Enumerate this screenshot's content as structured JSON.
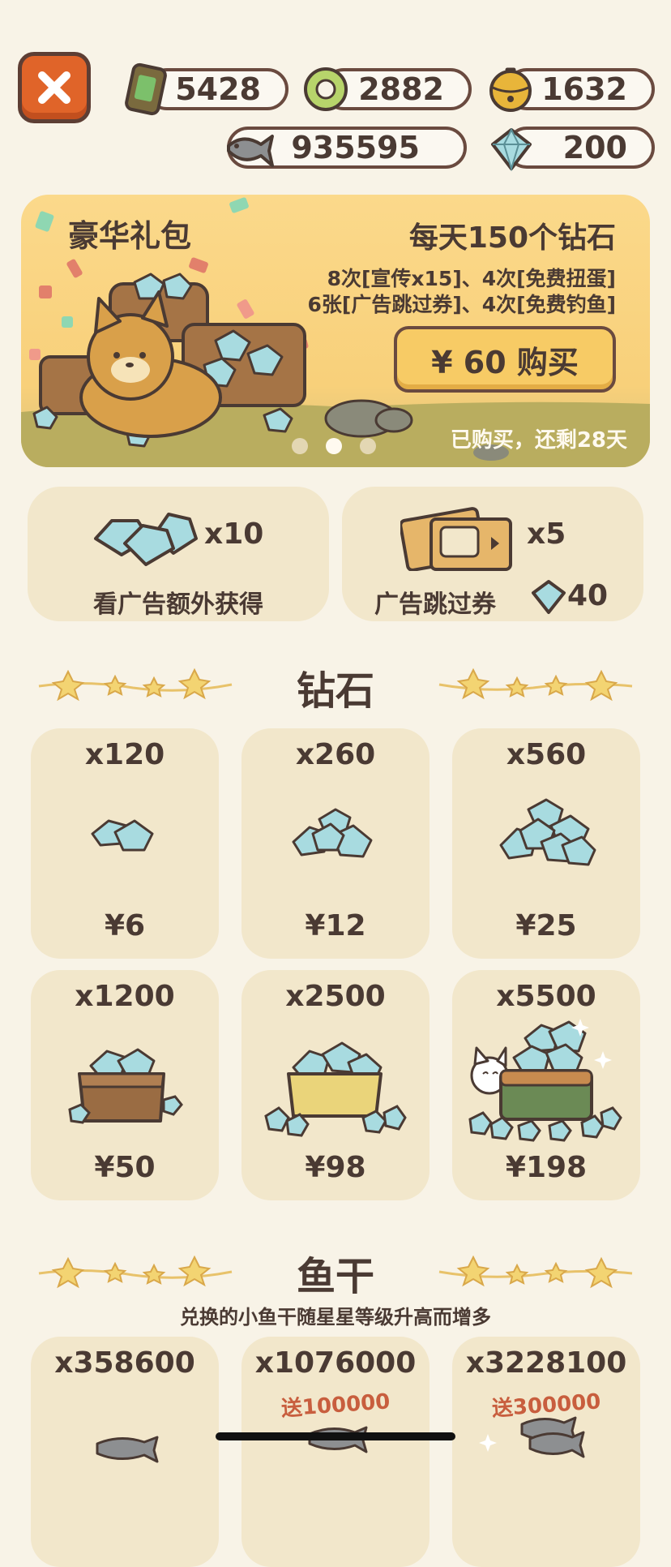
{
  "currencies": {
    "cans": "5428",
    "yarn": "2882",
    "bells": "1632",
    "fish": "935595",
    "diamonds": "200"
  },
  "banner": {
    "title": "豪华礼包",
    "headline": "每天150个钻石",
    "line1": "8次[宣传x15]、4次[免费扭蛋]",
    "line2": "6张[广告跳过券]、4次[免费钓鱼]",
    "buy_label": "¥ 60 购买",
    "status": "已购买，还剩28天",
    "page_dots": 3,
    "active_dot": 2
  },
  "features": [
    {
      "count": "x10",
      "label": "看广告额外获得"
    },
    {
      "count": "x5",
      "label": "广告跳过券",
      "cost": "40"
    }
  ],
  "diamond_section": {
    "title": "钻石",
    "items": [
      {
        "amount": "x120",
        "price": "¥6"
      },
      {
        "amount": "x260",
        "price": "¥12"
      },
      {
        "amount": "x560",
        "price": "¥25"
      },
      {
        "amount": "x1200",
        "price": "¥50"
      },
      {
        "amount": "x2500",
        "price": "¥98"
      },
      {
        "amount": "x5500",
        "price": "¥198"
      }
    ]
  },
  "fish_section": {
    "title": "鱼干",
    "subtitle": "兑换的小鱼干随星星等级升高而增多",
    "items": [
      {
        "amount": "x358600",
        "bonus": ""
      },
      {
        "amount": "x1076000",
        "bonus": "送100000"
      },
      {
        "amount": "x3228100",
        "bonus": "送300000"
      }
    ]
  },
  "colors": {
    "background": "#f8f3e7",
    "card": "#f2e7cb",
    "banner": "#f8d07a",
    "close_button": "#e06429",
    "text": "#4a3a33",
    "diamond": "#a8dbe0",
    "bonus_text": "#c85e3e"
  }
}
